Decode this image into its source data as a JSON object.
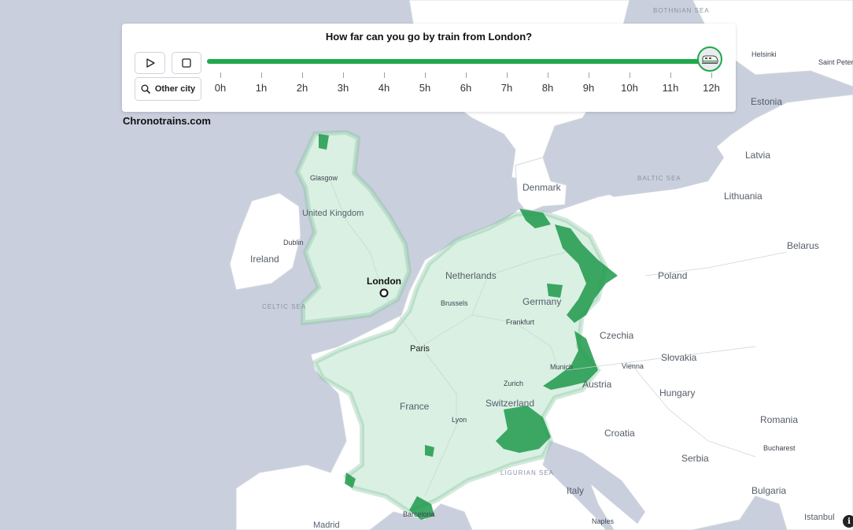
{
  "panel": {
    "title": "How far can you go by train from London?",
    "other_city_label": "Other city",
    "progress_fraction": 1.0,
    "timeline_labels": [
      "0h",
      "1h",
      "2h",
      "3h",
      "4h",
      "5h",
      "6h",
      "7h",
      "8h",
      "9h",
      "10h",
      "11h",
      "12h"
    ]
  },
  "brand": "Chronotrains.com",
  "info_icon_text": "i",
  "icons": {
    "play": "play-icon",
    "stop": "stop-icon",
    "search": "search-icon",
    "train": "train-icon",
    "info": "info-icon"
  },
  "colors": {
    "sea": "#c9cfdd",
    "land": "#ffffff",
    "reach_fill": "#d9f0e3",
    "reach_dark": "#1f9a4c",
    "accent_green": "#1fa84a"
  },
  "map": {
    "origin_city": "London",
    "countries": [
      "United Kingdom",
      "Ireland",
      "Netherlands",
      "Germany",
      "France",
      "Switzerland",
      "Italy",
      "Austria",
      "Czechia",
      "Slovakia",
      "Hungary",
      "Poland",
      "Belarus",
      "Lithuania",
      "Latvia",
      "Estonia",
      "Denmark",
      "Croatia",
      "Serbia",
      "Romania",
      "Bulgaria"
    ],
    "seas": [
      "CELTIC SEA",
      "BALTIC SEA",
      "BOTHNIAN SEA",
      "LIGURIAN SEA"
    ],
    "cities": [
      "Paris",
      "Glasgow",
      "Dublin",
      "Brussels",
      "Frankfurt",
      "Munich",
      "Zurich",
      "Lyon",
      "Vienna",
      "Madrid",
      "Barcelona",
      "Naples",
      "Bucharest",
      "Istanbul",
      "Helsinki",
      "Saint Petersburg"
    ],
    "labels": {
      "london": "London",
      "paris": "Paris",
      "united_kingdom": "United Kingdom",
      "ireland": "Ireland",
      "netherlands": "Netherlands",
      "germany": "Germany",
      "france": "France",
      "switzerland": "Switzerland",
      "italy": "Italy",
      "austria": "Austria",
      "czechia": "Czechia",
      "slovakia": "Slovakia",
      "hungary": "Hungary",
      "poland": "Poland",
      "belarus": "Belarus",
      "lithuania": "Lithuania",
      "latvia": "Latvia",
      "estonia": "Estonia",
      "denmark": "Denmark",
      "croatia": "Croatia",
      "serbia": "Serbia",
      "romania": "Romania",
      "bulgaria": "Bulgaria",
      "celtic_sea": "CELTIC SEA",
      "baltic_sea": "BALTIC SEA",
      "bothnian_sea": "BOTHNIAN SEA",
      "ligurian_sea": "LIGURIAN SEA",
      "glasgow": "Glasgow",
      "dublin": "Dublin",
      "brussels": "Brussels",
      "frankfurt": "Frankfurt",
      "munich": "Munich",
      "zurich": "Zurich",
      "lyon": "Lyon",
      "vienna": "Vienna",
      "madrid": "Madrid",
      "barcelona": "Barcelona",
      "naples": "Naples",
      "bucharest": "Bucharest",
      "istanbul": "Istanbul",
      "helsinki": "Helsinki",
      "saint_petersburg": "Saint Petersbu"
    }
  }
}
